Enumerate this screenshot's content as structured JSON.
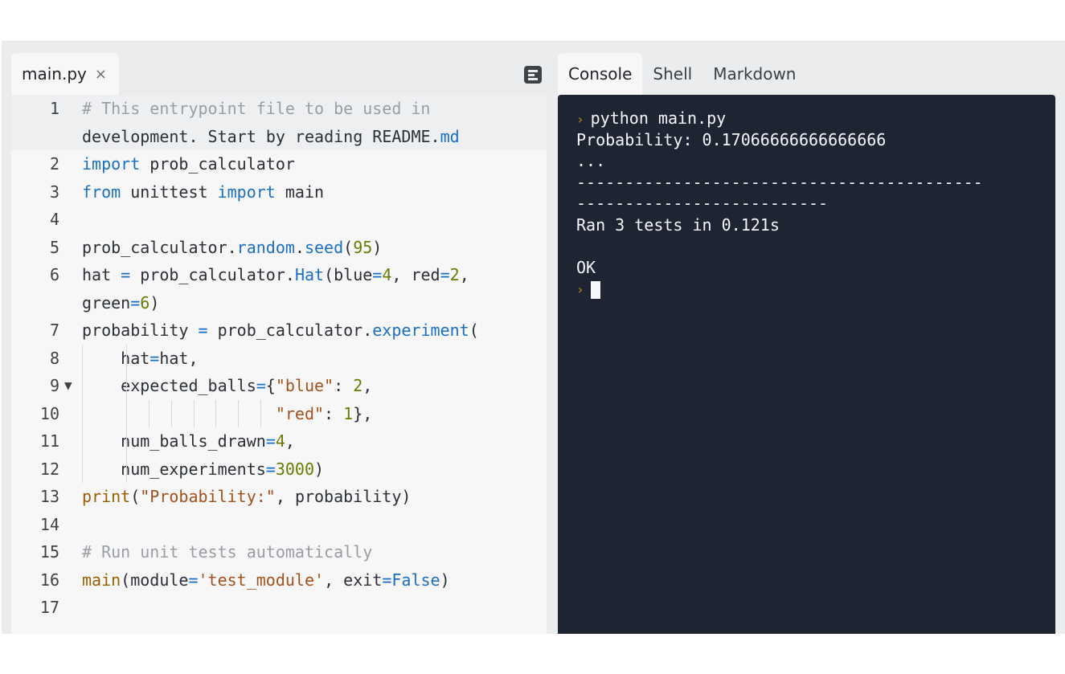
{
  "editor": {
    "tab": {
      "label": "main.py",
      "close_glyph": "×"
    },
    "outline_icon": "outline-icon",
    "lines": [
      {
        "num": "1",
        "text": "# This entrypoint file to be used in development. Start by reading README.md",
        "wrapped": [
          "# This entrypoint file to be used in",
          "development. Start by reading README.md"
        ]
      },
      {
        "num": "2",
        "text": "import prob_calculator"
      },
      {
        "num": "3",
        "text": "from unittest import main"
      },
      {
        "num": "4",
        "text": ""
      },
      {
        "num": "5",
        "text": "prob_calculator.random.seed(95)"
      },
      {
        "num": "6",
        "text": "hat = prob_calculator.Hat(blue=4, red=2, green=6)",
        "wrapped": [
          "hat = prob_calculator.Hat(blue=4, red=2,",
          "green=6)"
        ]
      },
      {
        "num": "7",
        "text": "probability = prob_calculator.experiment("
      },
      {
        "num": "8",
        "text": "    hat=hat,"
      },
      {
        "num": "9",
        "text": "    expected_balls={\"blue\": 2,",
        "folded_marker": "▼"
      },
      {
        "num": "10",
        "text": "                    \"red\": 1},"
      },
      {
        "num": "11",
        "text": "    num_balls_drawn=4,"
      },
      {
        "num": "12",
        "text": "    num_experiments=3000)"
      },
      {
        "num": "13",
        "text": "print(\"Probability:\", probability)"
      },
      {
        "num": "14",
        "text": ""
      },
      {
        "num": "15",
        "text": "# Run unit tests automatically"
      },
      {
        "num": "16",
        "text": "main(module='test_module', exit=False)"
      },
      {
        "num": "17",
        "text": ""
      }
    ]
  },
  "console": {
    "tabs": [
      {
        "label": "Console",
        "active": true
      },
      {
        "label": "Shell",
        "active": false
      },
      {
        "label": "Markdown",
        "active": false
      }
    ],
    "prompt_glyph": "›",
    "output": [
      {
        "type": "command",
        "text": "python main.py"
      },
      {
        "type": "out",
        "text": "Probability: 0.17066666666666666"
      },
      {
        "type": "out",
        "text": "..."
      },
      {
        "type": "out",
        "text": "------------------------------------------"
      },
      {
        "type": "out",
        "text": "--------------------------"
      },
      {
        "type": "out",
        "text": "Ran 3 tests in 0.121s"
      },
      {
        "type": "out",
        "text": ""
      },
      {
        "type": "out",
        "text": "OK"
      },
      {
        "type": "prompt",
        "text": ""
      }
    ]
  },
  "colors": {
    "keyword": "#1a6fc2",
    "function": "#9a5f00",
    "number": "#6b7a00",
    "string": "#a3511a",
    "comment": "#999ea5",
    "terminal_bg": "#1f2433",
    "prompt": "#b68c18"
  }
}
